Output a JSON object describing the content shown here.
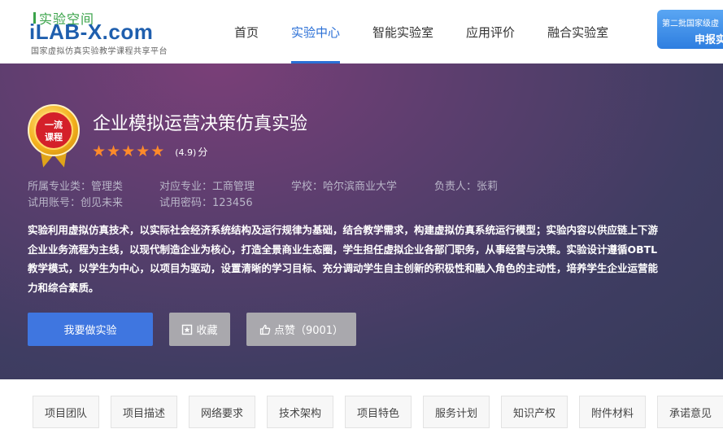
{
  "header": {
    "logo_cn": "实验空间",
    "logo_en": "iLAB-X.com",
    "logo_sub": "国家虚拟仿真实验教学课程共享平台",
    "nav": [
      {
        "label": "首页",
        "active": false
      },
      {
        "label": "实验中心",
        "active": true
      },
      {
        "label": "智能实验室",
        "active": false
      },
      {
        "label": "应用评价",
        "active": false
      },
      {
        "label": "融合实验室",
        "active": false
      }
    ],
    "banner_line1": "第二批国家级虚",
    "banner_line2": "申报实"
  },
  "course": {
    "badge_text_1": "一流",
    "badge_text_2": "课程",
    "title": "企业模拟运营决策仿真实验",
    "rating": 4.9,
    "stars": 5,
    "score_text": "(4.9)",
    "score_unit": "分",
    "category": "所属专业类：管理类",
    "major": "对应专业：工商管理",
    "school": "学校：哈尔滨商业大学",
    "owner": "负责人：张莉",
    "account": "试用账号：创见未来",
    "password": "试用密码：123456",
    "description": "实验利用虚拟仿真技术，以实际社会经济系统结构及运行规律为基础，结合教学需求，构建虚拟仿真系统运行模型；实验内容以供应链上下游企业业务流程为主线，以现代制造企业为核心，打造全景商业生态圈，学生担任虚拟企业各部门职务，从事经营与决策。实验设计遵循OBTL教学模式，以学生为中心，以项目为驱动，设置清晰的学习目标、充分调动学生自主创新的积极性和融入角色的主动性，培养学生企业运营能力和综合素质。"
  },
  "actions": {
    "do_experiment": "我要做实验",
    "favorite": "收藏",
    "like": "点赞（9001）"
  },
  "tabs": [
    "项目团队",
    "项目描述",
    "网络要求",
    "技术架构",
    "项目特色",
    "服务计划",
    "知识产权",
    "附件材料",
    "承诺意见"
  ],
  "colors": {
    "accent": "#2a6fd6",
    "primary_button": "#3f76e0",
    "star": "#ff8a2a",
    "hero_bg": "#4a3d66"
  }
}
